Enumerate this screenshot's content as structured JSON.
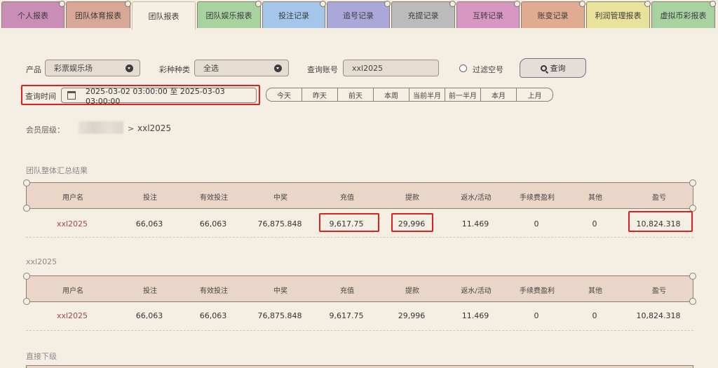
{
  "tabs": [
    {
      "label": "个人报表",
      "color": "#c98db8"
    },
    {
      "label": "团队体育报表",
      "color": "#d8a795"
    },
    {
      "label": "团队报表",
      "color": "#f6efe4"
    },
    {
      "label": "团队娱乐报表",
      "color": "#a8d3a1"
    },
    {
      "label": "投注记录",
      "color": "#a3c6ea"
    },
    {
      "label": "追号记录",
      "color": "#aaa8d8"
    },
    {
      "label": "充提记录",
      "color": "#bbbbbb"
    },
    {
      "label": "互转记录",
      "color": "#d796c4"
    },
    {
      "label": "账变记录",
      "color": "#dfac92"
    },
    {
      "label": "利润管理报表",
      "color": "#e9e29a"
    },
    {
      "label": "虚拟币彩报表",
      "color": "#a8d3a1"
    }
  ],
  "filters": {
    "product_label": "产品",
    "product_value": "彩票娱乐场",
    "lottery_label": "彩种种类",
    "lottery_value": "全选",
    "account_label": "查询账号",
    "account_value": "xxl2025",
    "filter_empty_label": "过滤空号",
    "query_button": "查询",
    "time_label": "查询时间",
    "time_range": "2025-03-02 03:00:00 至 2025-03-03 03:00:00",
    "quick_ranges": [
      "今天",
      "昨天",
      "前天",
      "本周",
      "当前半月",
      "前一半月",
      "本月",
      "上月"
    ]
  },
  "member_level": {
    "label": "会员层级：",
    "separator": ">",
    "account": "xxl2025"
  },
  "columns": [
    "用户名",
    "投注",
    "有效投注",
    "中奖",
    "充值",
    "提款",
    "返水/活动",
    "手续费盈利",
    "其他",
    "盈亏"
  ],
  "summary": {
    "title": "团队整体汇总结果",
    "row": [
      "xxl2025",
      "66,063",
      "66,063",
      "76,875.848",
      "9,617.75",
      "29,996",
      "11.469",
      "0",
      "0",
      "10,824.318"
    ]
  },
  "user_section": {
    "title": "xxl2025",
    "row": [
      "xxl2025",
      "66,063",
      "66,063",
      "76,875.848",
      "9,617.75",
      "29,996",
      "11.469",
      "0",
      "0",
      "10,824.318"
    ]
  },
  "direct_section": {
    "title": "直接下级"
  }
}
